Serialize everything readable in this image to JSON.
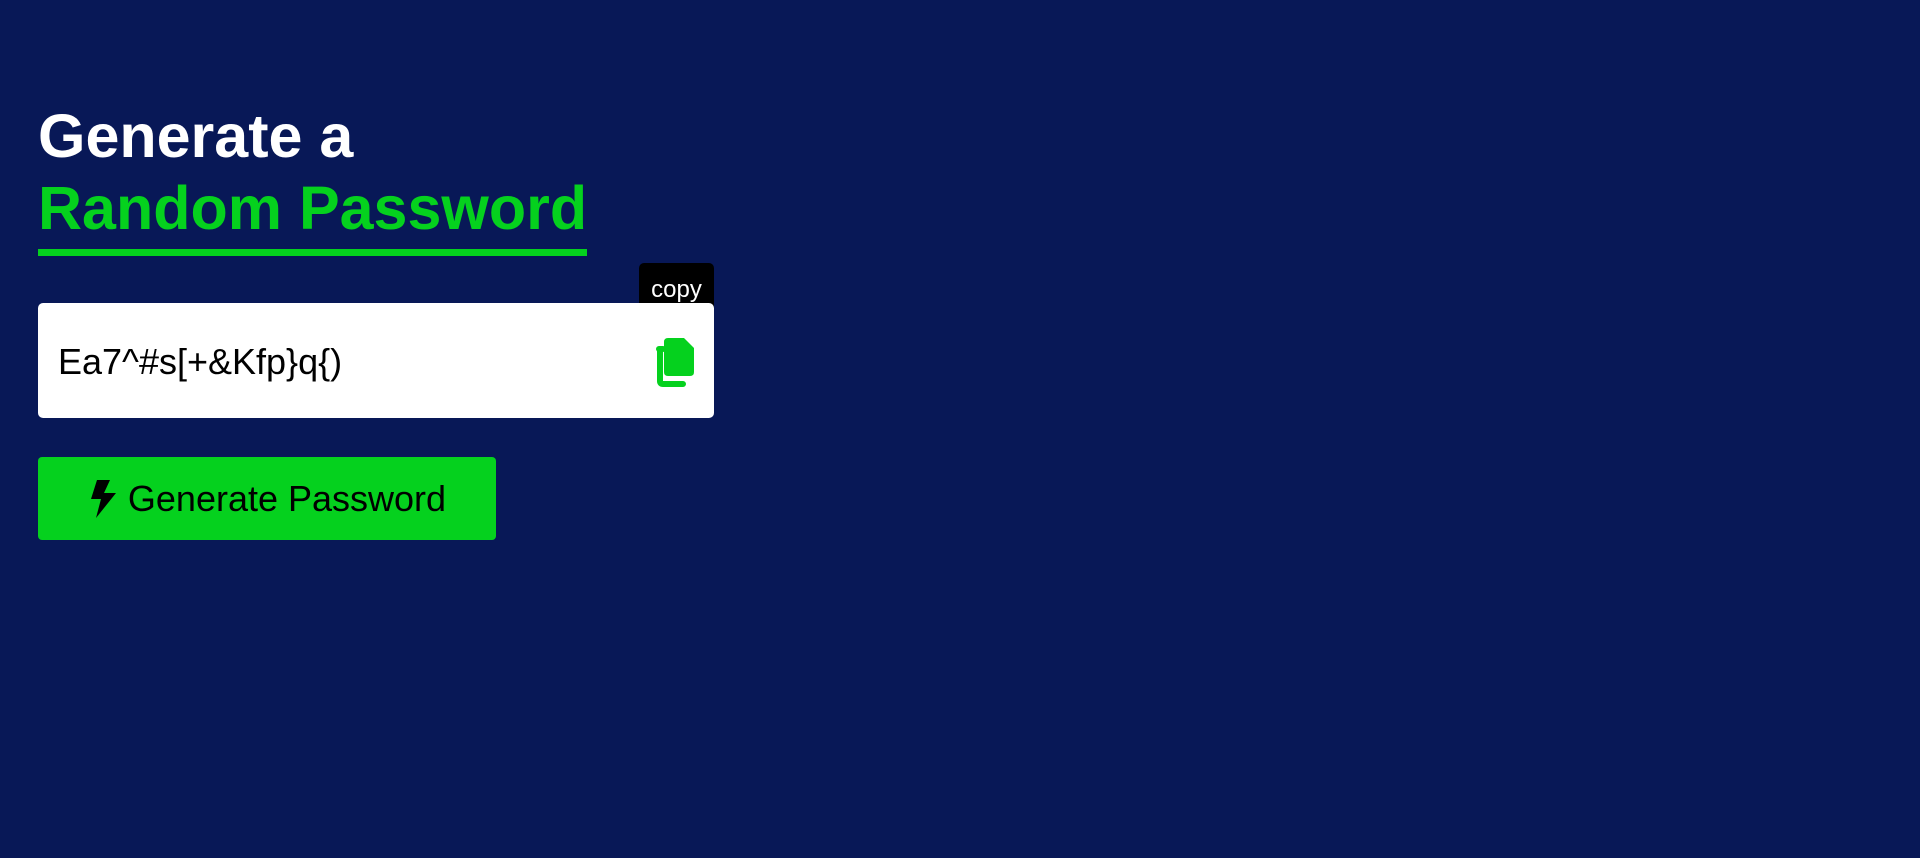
{
  "heading": {
    "line1": "Generate a",
    "line2": "Random Password"
  },
  "password": {
    "value": "Ea7^#s[+&Kfp}q{)"
  },
  "copy": {
    "tooltip": "copy",
    "icon": "copy-icon"
  },
  "generate": {
    "label": "Generate Password",
    "icon": "bolt-icon"
  },
  "colors": {
    "background": "#081857",
    "accent": "#05d11e",
    "panel": "#ffffff",
    "tooltip": "#000000"
  }
}
